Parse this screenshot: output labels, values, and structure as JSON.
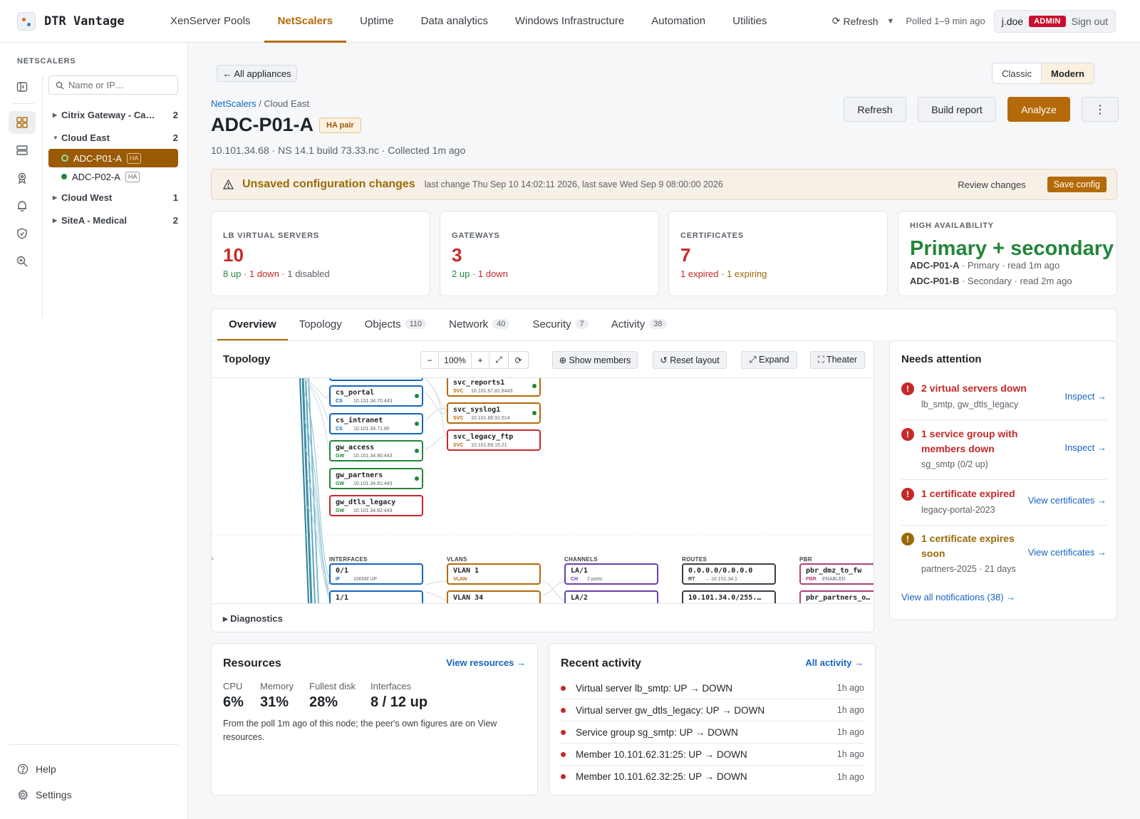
{
  "app": {
    "title": "DTR Vantage"
  },
  "nav": {
    "items": [
      "XenServer Pools",
      "NetScalers",
      "Uptime",
      "Data analytics",
      "Windows Infrastructure",
      "Automation",
      "Utilities"
    ],
    "active": "NetScalers",
    "refresh_label": "Refresh",
    "polled": "Polled 1–9 min ago",
    "user": "j.doe",
    "role_badge": "ADMIN",
    "signout": "Sign out"
  },
  "sidebar": {
    "title": "NETSCALERS",
    "search_placeholder": "Name or IP…",
    "groups": [
      {
        "name": "Citrix Gateway - Ca…",
        "count": "2",
        "expanded": false
      },
      {
        "name": "Cloud East",
        "count": "2",
        "expanded": true,
        "devices": [
          {
            "name": "ADC-P01-A",
            "tag": "HA",
            "active": true
          },
          {
            "name": "ADC-P02-A",
            "tag": "HA",
            "active": false
          }
        ]
      },
      {
        "name": "Cloud West",
        "count": "1",
        "expanded": false
      },
      {
        "name": "SiteA - Medical",
        "count": "2",
        "expanded": false
      }
    ],
    "footer": {
      "help": "Help",
      "settings": "Settings"
    }
  },
  "page": {
    "back": "← All appliances",
    "view_toggle": {
      "classic": "Classic",
      "modern": "Modern",
      "selected": "Modern"
    },
    "breadcrumb": {
      "root": "NetScalers",
      "sep": " / ",
      "current": "Cloud East"
    },
    "title": "ADC-P01-A",
    "badge": "HA pair",
    "subtitle": "10.101.34.68 · NS 14.1 build 73.33.nc · Collected 1m ago",
    "actions": {
      "refresh": "Refresh",
      "report": "Build report",
      "analyze": "Analyze",
      "more": "⋮"
    }
  },
  "banner": {
    "title": "Unsaved configuration changes",
    "detail": "last change Thu Sep 10 14:02:11 2026, last save Wed Sep 9 08:00:00 2026",
    "review": "Review changes",
    "save": "Save config"
  },
  "stats": {
    "lb": {
      "label": "LB VIRTUAL SERVERS",
      "value": "10",
      "up": "8 up",
      "sep": " · ",
      "down": "1 down",
      "disabled": "1 disabled"
    },
    "gw": {
      "label": "GATEWAYS",
      "value": "3",
      "up": "2 up",
      "sep": " · ",
      "down": "1 down"
    },
    "certs": {
      "label": "CERTIFICATES",
      "value": "7",
      "expired": "1 expired",
      "sep": " · ",
      "expiring": "1 expiring"
    },
    "ha": {
      "label": "HIGH AVAILABILITY",
      "value": "Primary + secondary",
      "nodes": [
        {
          "name": "ADC-P01-A",
          "detail": " · Primary · read 1m ago"
        },
        {
          "name": "ADC-P01-B",
          "detail": " · Secondary · read 2m ago"
        }
      ]
    }
  },
  "tabs": [
    {
      "label": "Overview",
      "count": ""
    },
    {
      "label": "Topology",
      "count": ""
    },
    {
      "label": "Objects",
      "count": "110"
    },
    {
      "label": "Network",
      "count": "40"
    },
    {
      "label": "Security",
      "count": "7"
    },
    {
      "label": "Activity",
      "count": "38"
    }
  ],
  "topology": {
    "title": "Topology",
    "zoom": "100%",
    "zoom_out": "−",
    "zoom_in": "+",
    "fit": "⤢",
    "rotate": "⟳",
    "show_members": "⊕ Show members",
    "reset_layout": "↺ Reset layout",
    "expand": "⤢ Expand",
    "theater": "⛶ Theater",
    "diagnostics": "▸ Diagnostics",
    "columns": [
      "INTERFACES",
      "VLANS",
      "CHANNELS",
      "ROUTES",
      "PBR"
    ],
    "nodes": [
      {
        "name": "cs_portal",
        "kind": "CS",
        "ip": "10.101.34.70:443",
        "col": "vs",
        "status": "up"
      },
      {
        "name": "cs_intranet",
        "kind": "CS",
        "ip": "10.101.34.71:80",
        "col": "vs",
        "status": "up"
      },
      {
        "name": "gw_access",
        "kind": "GW",
        "ip": "10.101.34.90:443",
        "col": "vs",
        "status": "up"
      },
      {
        "name": "gw_partners",
        "kind": "GW",
        "ip": "10.101.34.91:443",
        "col": "vs",
        "status": "up"
      },
      {
        "name": "gw_dtls_legacy",
        "kind": "GW",
        "ip": "10.101.34.92:443",
        "col": "vs",
        "status": "down"
      },
      {
        "name": "svc_reports1",
        "kind": "SVC",
        "ip": "10.101.67.81:8443",
        "col": "svc",
        "status": "up"
      },
      {
        "name": "svc_syslog1",
        "kind": "SVC",
        "ip": "10.101.68.91:514",
        "col": "svc",
        "status": "up"
      },
      {
        "name": "svc_legacy_ftp",
        "kind": "SVC",
        "ip": "10.101.69.15:21",
        "col": "svc",
        "status": "down"
      },
      {
        "name": "0/1",
        "kind": "IF",
        "ip": "1000M UP",
        "col": "if",
        "status": "none"
      },
      {
        "name": "1/1",
        "kind": "IF",
        "ip": "",
        "col": "if",
        "status": "none"
      },
      {
        "name": "VLAN 1",
        "kind": "VLAN",
        "ip": "",
        "col": "vlan",
        "status": "none"
      },
      {
        "name": "VLAN 34",
        "kind": "VLAN",
        "ip": "",
        "col": "vlan",
        "status": "none"
      },
      {
        "name": "LA/1",
        "kind": "CH",
        "ip": "2 ports",
        "col": "ch",
        "status": "none"
      },
      {
        "name": "LA/2",
        "kind": "CH",
        "ip": "",
        "col": "ch",
        "status": "none"
      },
      {
        "name": "0.0.0.0/0.0.0.0",
        "kind": "RT",
        "ip": "→ 10.101.34.1",
        "col": "rt",
        "status": "none"
      },
      {
        "name": "10.101.34.0/255.…",
        "kind": "RT",
        "ip": "",
        "col": "rt",
        "status": "none"
      },
      {
        "name": "pbr_dmz_to_fw",
        "kind": "PBR",
        "ip": "ENABLED",
        "col": "pbr",
        "status": "none"
      },
      {
        "name": "pbr_partners_o…",
        "kind": "PBR",
        "ip": "",
        "col": "pbr",
        "status": "none"
      }
    ]
  },
  "attention": {
    "title": "Needs attention",
    "items": [
      {
        "title": "2 virtual servers down",
        "sub": "lb_smtp, gw_dtls_legacy",
        "action": "Inspect →",
        "level": "error"
      },
      {
        "title": "1 service group with members down",
        "sub": "sg_smtp (0/2 up)",
        "action": "Inspect →",
        "level": "error"
      },
      {
        "title": "1 certificate expired",
        "sub": "legacy-portal-2023",
        "action": "View certificates →",
        "level": "error"
      },
      {
        "title": "1 certificate expires soon",
        "sub": "partners-2025 · 21 days",
        "action": "View certificates →",
        "level": "warn"
      }
    ],
    "view_all": "View all notifications (38) →"
  },
  "resources": {
    "title": "Resources",
    "link": "View resources →",
    "metrics": [
      {
        "label": "CPU",
        "value": "6%"
      },
      {
        "label": "Memory",
        "value": "31%"
      },
      {
        "label": "Fullest disk",
        "value": "28%"
      },
      {
        "label": "Interfaces",
        "value": "8 / 12 up"
      }
    ],
    "note": "From the poll 1m ago of this node; the peer's own figures are on View resources."
  },
  "activity": {
    "title": "Recent activity",
    "link": "All activity →",
    "items": [
      {
        "text": "Virtual server lb_smtp: UP → DOWN",
        "time": "1h ago"
      },
      {
        "text": "Virtual server gw_dtls_legacy: UP → DOWN",
        "time": "1h ago"
      },
      {
        "text": "Service group sg_smtp: UP → DOWN",
        "time": "1h ago"
      },
      {
        "text": "Member 10.101.62.31:25: UP → DOWN",
        "time": "1h ago"
      },
      {
        "text": "Member 10.101.62.32:25: UP → DOWN",
        "time": "1h ago"
      }
    ]
  },
  "colors": {
    "accent": "#b46a08",
    "error": "#c62828",
    "success": "#22863a",
    "warn": "#9a6a06",
    "link": "#1565c0"
  }
}
